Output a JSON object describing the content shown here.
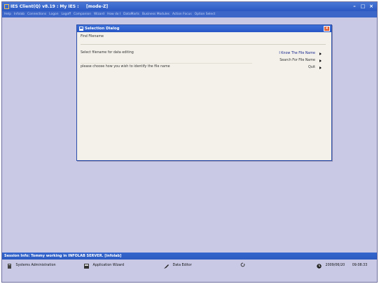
{
  "window": {
    "title": "IES Client(Q) v8.19 : My IES :",
    "mode": "[mode-Z]"
  },
  "menu": [
    "Help",
    "Infolab",
    "Connections",
    "Logon",
    "Logoff",
    "Companion",
    "Wizard",
    "How do I",
    "DataMarts",
    "Business Modules",
    "Action Focus",
    "Option Select"
  ],
  "dialog": {
    "title": "Selection Dialog",
    "find_label": "Find Filename",
    "select_label": "Select filename for data editing",
    "choose_label": "please choose how you wish to identify the file name",
    "options": [
      {
        "label": "I Know The File Name"
      },
      {
        "label": "Search For File Name"
      },
      {
        "label": "Quit"
      }
    ]
  },
  "session": "Session Info: Tommy working in INFOLAB SERVER.  [infolab]",
  "taskbar": {
    "systems_admin": "Systems Administration",
    "app_wizard": "Application Wizard",
    "data_editor": "Data Editor",
    "date": "2009/06/20",
    "time": "09:08:33"
  }
}
